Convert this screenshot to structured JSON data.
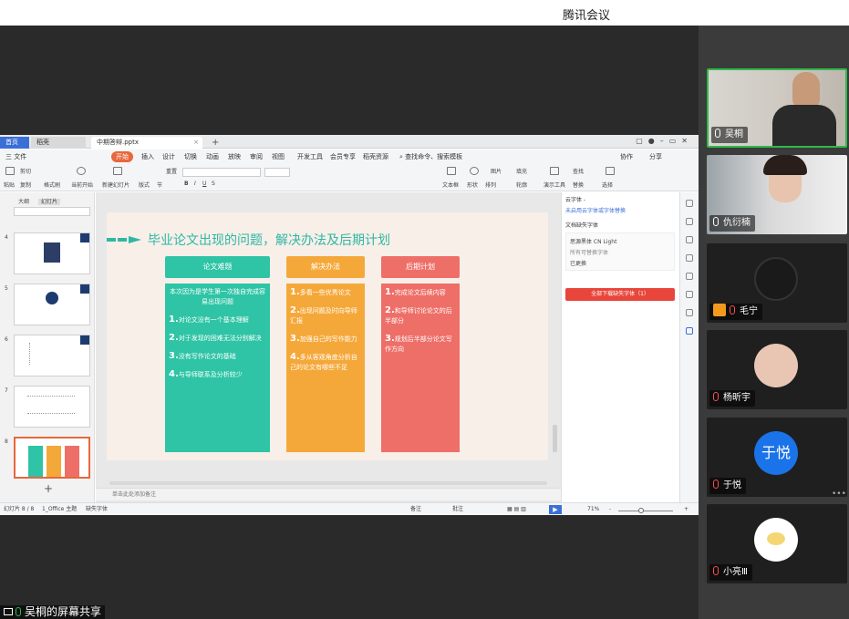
{
  "app": {
    "title": "腾讯会议"
  },
  "wps": {
    "tabs": [
      {
        "label": "首页"
      },
      {
        "label": "稻壳"
      },
      {
        "label": "中期答辩.pptx"
      }
    ],
    "new_tab": "+",
    "menu": [
      {
        "label": "三 文件"
      },
      {
        "label": "开始"
      },
      {
        "label": "插入"
      },
      {
        "label": "设计"
      },
      {
        "label": "切换"
      },
      {
        "label": "动画"
      },
      {
        "label": "放映"
      },
      {
        "label": "审阅"
      },
      {
        "label": "视图"
      },
      {
        "label": "开发工具"
      },
      {
        "label": "会员专享"
      },
      {
        "label": "稻壳资源"
      }
    ],
    "search_placeholder": "查找命令、搜索模板",
    "collab": "协作",
    "share": "分享",
    "ribbon": {
      "paste": "粘贴",
      "cut": "剪切",
      "copy": "复制",
      "format": "格式刷",
      "from_current": "当前开始",
      "new_slide": "新建幻灯片",
      "layout": "版式",
      "section": "节",
      "reset": "重置",
      "textbox": "文本框",
      "shape": "形状",
      "arrange": "排列",
      "outline": "轮廓",
      "smart_tools": "演示工具",
      "replace": "替换",
      "find": "查找",
      "select": "选择",
      "picture": "图片",
      "fill": "填充"
    },
    "slide_panel": {
      "tab_outline": "大纲",
      "tab_slides": "幻灯片",
      "slide_numbers": [
        "4",
        "5",
        "6",
        "7",
        "8"
      ],
      "add": "+"
    },
    "slide": {
      "title": "毕业论文出现的问题，解决办法及后期计划",
      "columns": [
        {
          "header": "论文难题",
          "color": "#2ec4a5",
          "intro": "本次因为是学生第一次独自完成容易出现问题",
          "items": [
            {
              "n": "1.",
              "text": "对论文没有一个基本理解"
            },
            {
              "n": "2.",
              "text": "对于发现的困难无法分别解决"
            },
            {
              "n": "3.",
              "text": "没有写作论文的基础"
            },
            {
              "n": "4.",
              "text": "与导师联系及分析较少"
            }
          ]
        },
        {
          "header": "解决办法",
          "color": "#f5a83a",
          "intro": "",
          "items": [
            {
              "n": "1.",
              "text": "多看一些优秀论文"
            },
            {
              "n": "2.",
              "text": "出现问题及时向导师汇报"
            },
            {
              "n": "3.",
              "text": "加强自己的写作能力"
            },
            {
              "n": "4.",
              "text": "多从客观角度分析自己的论文有哪些不足"
            }
          ]
        },
        {
          "header": "后期计划",
          "color": "#ee6f68",
          "intro": "",
          "items": [
            {
              "n": "1.",
              "text": "完成论文后续内容"
            },
            {
              "n": "2.",
              "text": "和导师讨论论文的后半部分"
            },
            {
              "n": "3.",
              "text": "规划后半部分论文写作方向"
            }
          ]
        }
      ]
    },
    "notes_placeholder": "单击此处添加备注",
    "task_pane": {
      "title": "云字体 -",
      "link": "未启用云字体或字体替换",
      "subtitle": "文档缺失字体",
      "font_name": "思源黑体 CN Light",
      "font_note": "所有可替换字体",
      "font_missing": "已更换",
      "download_all": "全部下载缺失字体（1）"
    },
    "status": {
      "slide_count": "幻灯片 8 / 8",
      "theme": "1_Office 主题",
      "font_missing": "缺失字体",
      "notes": "备注",
      "comments": "批注",
      "zoom": "71%",
      "minus": "-",
      "plus": "+"
    }
  },
  "participants": [
    {
      "name": "吴桐",
      "active": true
    },
    {
      "name": "仇衍楠"
    },
    {
      "name": "毛宁",
      "host": true
    },
    {
      "name": "杨昕宇"
    },
    {
      "name": "于悦",
      "avatar_text": "于悦",
      "avatar_color": "#1a73e8"
    },
    {
      "name": "小亮Ⅲ"
    }
  ],
  "more": "•••",
  "share_status": "吴桐的屏幕共享"
}
